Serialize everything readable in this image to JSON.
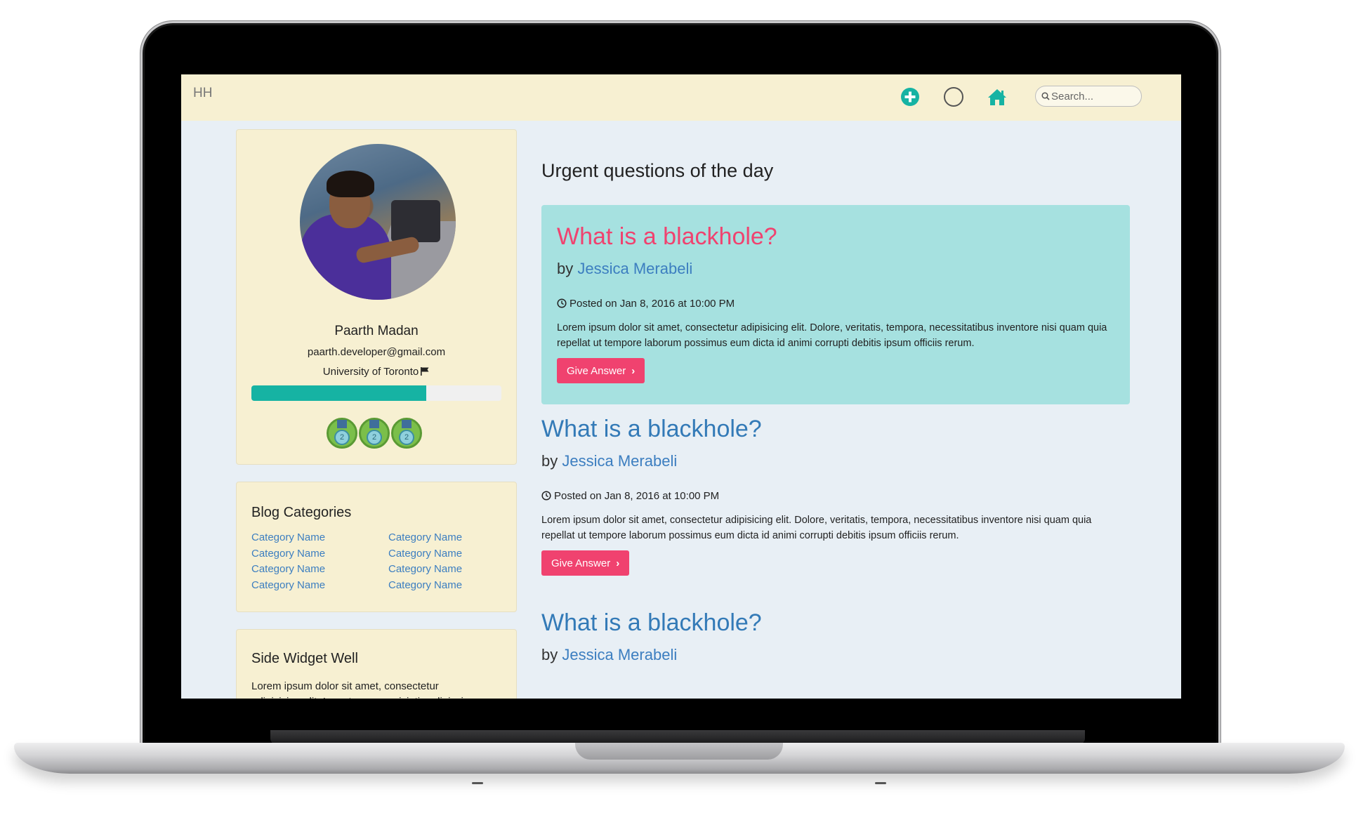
{
  "navbar": {
    "brand": "HH",
    "icons": [
      "plus-circle-icon",
      "circle-icon",
      "home-icon",
      "search-icon"
    ],
    "search_placeholder": "Search..."
  },
  "profile": {
    "name": "Paarth Madan",
    "email": "paarth.developer@gmail.com",
    "school": "University of Toronto",
    "progress_percent": 70,
    "badges": [
      "2",
      "2",
      "2"
    ]
  },
  "categories": {
    "title": "Blog Categories",
    "left": [
      "Category Name",
      "Category Name",
      "Category Name",
      "Category Name"
    ],
    "right": [
      "Category Name",
      "Category Name",
      "Category Name",
      "Category Name"
    ]
  },
  "side_widget": {
    "title": "Side Widget Well",
    "text": "Lorem ipsum dolor sit amet, consectetur adipisicing elit. Inventore, perspiciatis adipisci"
  },
  "main": {
    "section_title": "Urgent questions of the day",
    "posts": [
      {
        "title": "What is a blackhole?",
        "by": "by",
        "author": "Jessica Merabeli",
        "posted": "Posted on Jan 8, 2016 at 10:00 PM",
        "body": "Lorem ipsum dolor sit amet, consectetur adipisicing elit. Dolore, veritatis, tempora, necessitatibus inventore nisi quam quia repellat ut tempore laborum possimus eum dicta id animi corrupti debitis ipsum officiis rerum.",
        "button": "Give Answer"
      },
      {
        "title": "What is a blackhole?",
        "by": "by",
        "author": "Jessica Merabeli",
        "posted": "Posted on Jan 8, 2016 at 10:00 PM",
        "body": "Lorem ipsum dolor sit amet, consectetur adipisicing elit. Dolore, veritatis, tempora, necessitatibus inventore nisi quam quia repellat ut tempore laborum possimus eum dicta id animi corrupti debitis ipsum officiis rerum.",
        "button": "Give Answer"
      },
      {
        "title": "What is a blackhole?",
        "by": "by",
        "author": "Jessica Merabeli"
      }
    ]
  },
  "colors": {
    "navbar_bg": "#f7f0d2",
    "page_bg": "#e8eff5",
    "featured_bg": "#a6e1e0",
    "accent_pink": "#f0426f",
    "link_blue": "#337ab7",
    "teal": "#16b3a3"
  }
}
